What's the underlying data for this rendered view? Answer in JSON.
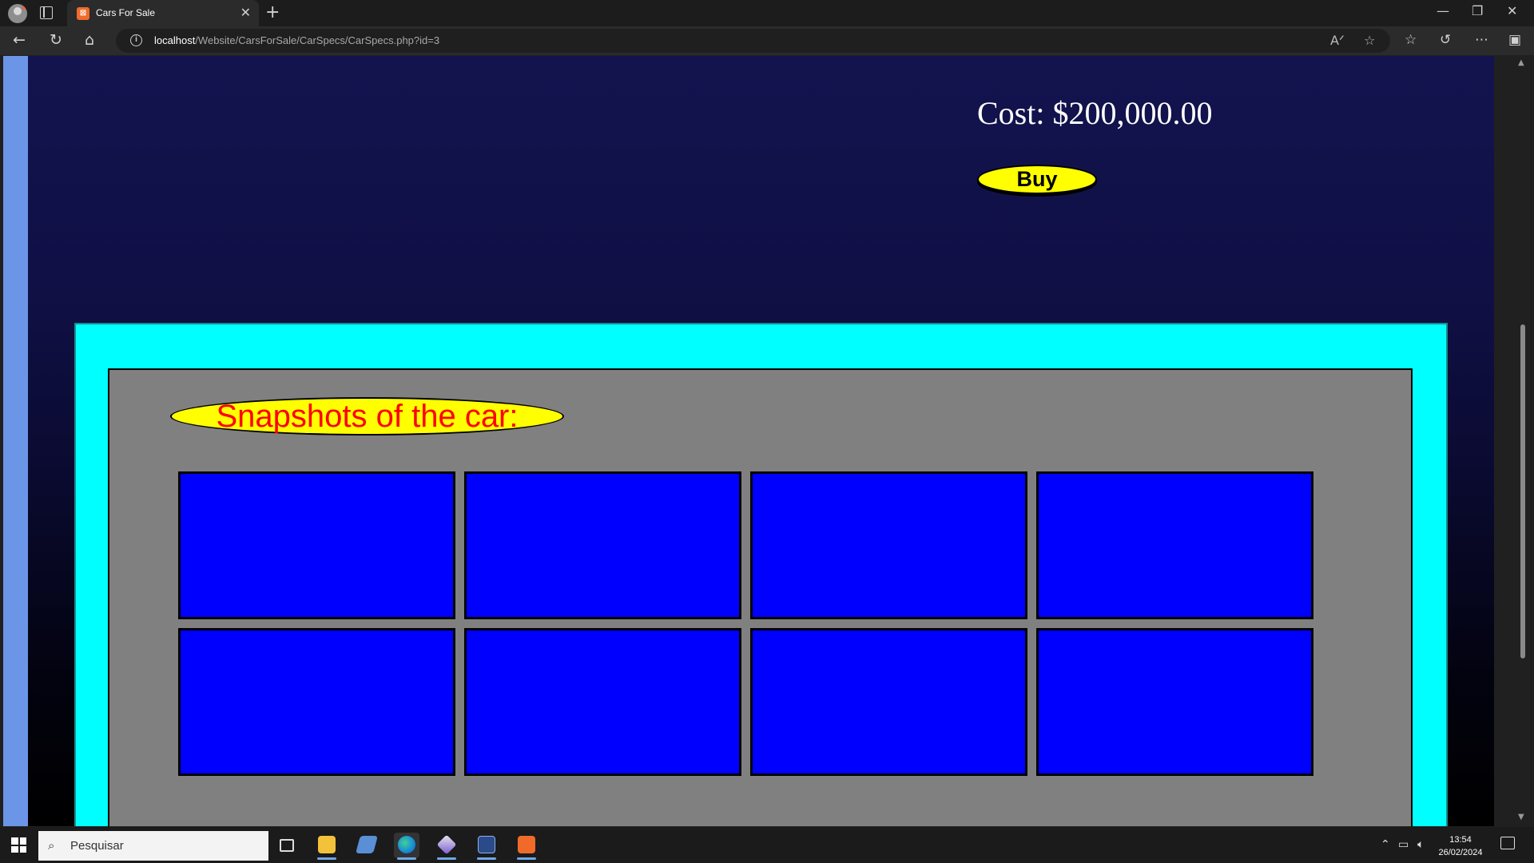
{
  "browser": {
    "tab_title": "Cars For Sale",
    "tab_favicon": "xampp-icon",
    "url_host": "localhost",
    "url_path": "/Website/CarsForSale/CarSpecs/CarSpecs.php?id=3"
  },
  "page": {
    "cost_text": "Cost: $200,000.00",
    "buy_label": "Buy",
    "snapshots_label": "Snapshots of the car:",
    "thumbnail_count": 8,
    "colors": {
      "background_top": "#13134f",
      "background_bottom": "#000000",
      "frame": "#00ffff",
      "panel": "#808080",
      "thumbnail": "#0000ff",
      "button": "#ffff00",
      "snapshot_text": "#ff0000",
      "left_strip": "#6b95e6"
    }
  },
  "taskbar": {
    "search_placeholder": "Pesquisar",
    "time": "13:54",
    "date": "26/02/2024",
    "apps": [
      "task-view-icon",
      "file-explorer-icon",
      "app-icon",
      "edge-icon",
      "app-icon-2",
      "app-icon-3",
      "xampp-icon"
    ]
  }
}
